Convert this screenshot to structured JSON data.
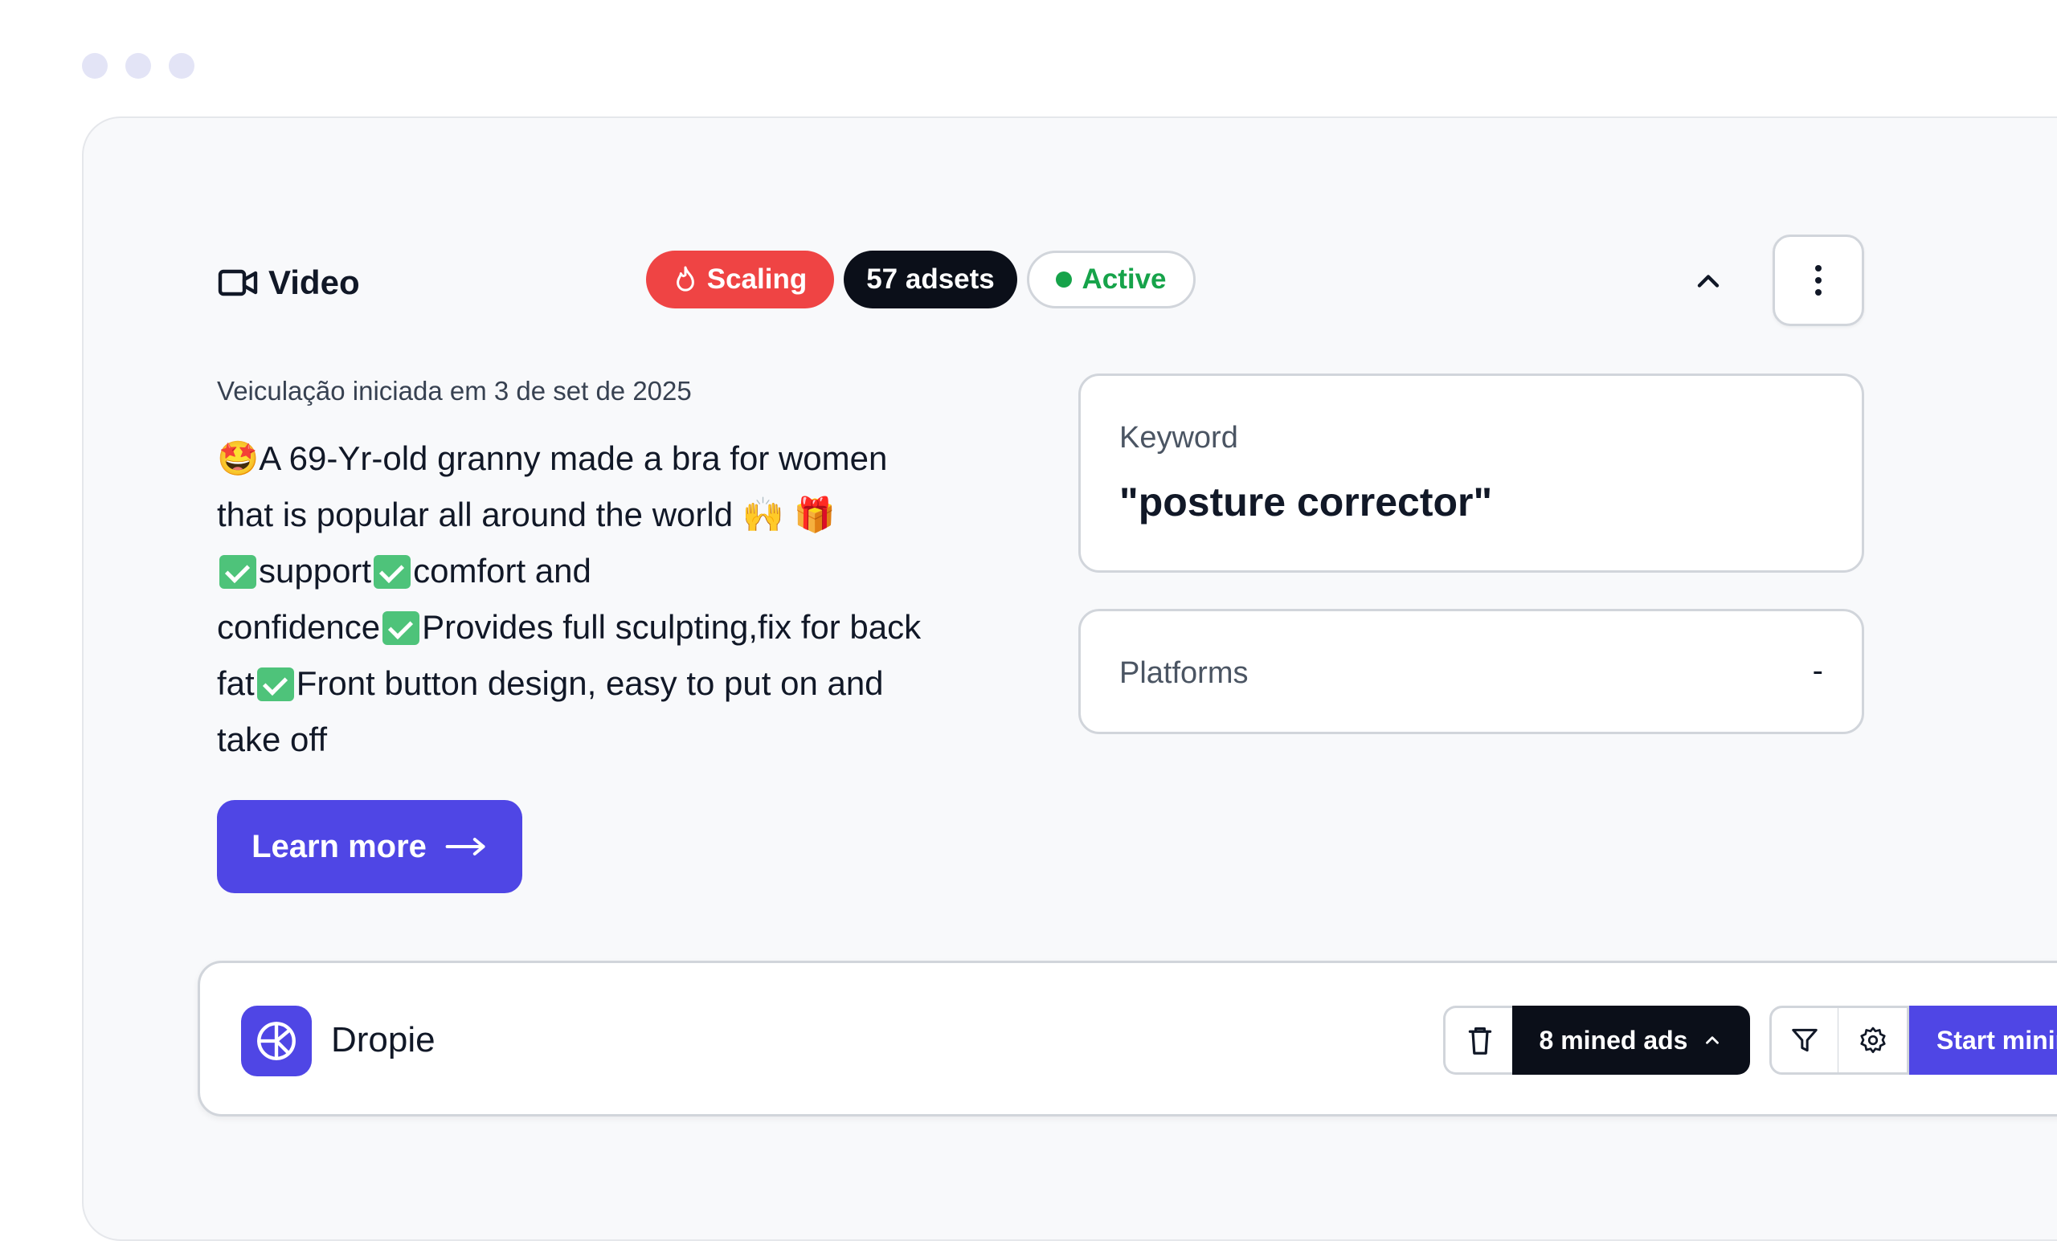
{
  "ad_card": {
    "type_label": "Video",
    "type_icon": "video-camera-icon",
    "badges": {
      "scaling": "Scaling",
      "adsets": "57 adsets",
      "status": "Active"
    },
    "started_text": "Veiculação iniciada em 3 de set de 2025",
    "ad_text": {
      "line1": "A 69-Yr-old granny made a bra for women",
      "line2": "that is popular all around the world",
      "line3a": "support",
      "line3b": "comfort and",
      "line4a": "confidence",
      "line4b": "Provides full sculpting,fix for back",
      "line5a": "fat",
      "line5b": "Front button design, easy to put on and",
      "line6": "take off"
    },
    "learn_more": "Learn more",
    "keyword": {
      "label": "Keyword",
      "value": "\"posture corrector\""
    },
    "platforms": {
      "label": "Platforms",
      "value": "-"
    }
  },
  "footer_bar": {
    "brand_name": "Dropie",
    "mined_ads": "8 mined ads",
    "start_button": "Start minin"
  },
  "colors": {
    "accent": "#4f46e5",
    "scaling": "#ef4444",
    "active": "#16a34a",
    "dark": "#0b0f19"
  }
}
